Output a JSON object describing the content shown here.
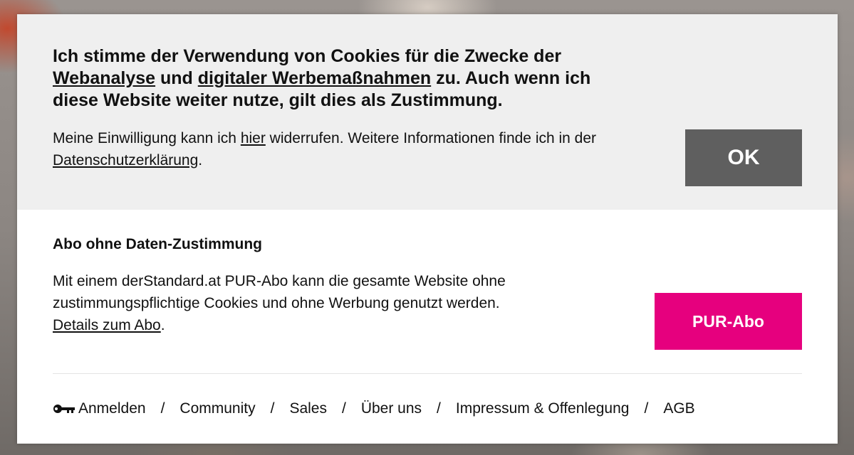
{
  "consent": {
    "headline_part1": "Ich stimme der Verwendung von Cookies für die Zwecke der ",
    "headline_link1": "Webanalyse",
    "headline_part2": " und ",
    "headline_link2": "digitaler Werbemaßnahmen",
    "headline_part3": " zu. Auch wenn ich diese Website weiter nutze, gilt dies als Zustimmung.",
    "info_part1": "Meine Einwilligung kann ich ",
    "info_link1": "hier",
    "info_part2": " widerrufen. Weitere Informationen finde ich in der ",
    "info_link2": "Datenschutzerklärung",
    "info_part3": ".",
    "ok_label": "OK",
    "ok_color": "#5f5f5f"
  },
  "abo": {
    "title": "Abo ohne Daten-Zustimmung",
    "text": "Mit einem derStandard.at PUR-Abo kann die gesamte Website ohne zustimmungspflichtige Cookies und ohne Werbung genutzt werden.",
    "details_link": "Details zum Abo",
    "details_suffix": ".",
    "button_label": "PUR-Abo",
    "button_color": "#e6007e"
  },
  "footer": {
    "separator": "/",
    "login_icon": "key-icon",
    "items": [
      {
        "label": "Anmelden"
      },
      {
        "label": "Community"
      },
      {
        "label": "Sales"
      },
      {
        "label": "Über uns"
      },
      {
        "label": "Impressum & Offenlegung"
      },
      {
        "label": "AGB"
      }
    ]
  }
}
